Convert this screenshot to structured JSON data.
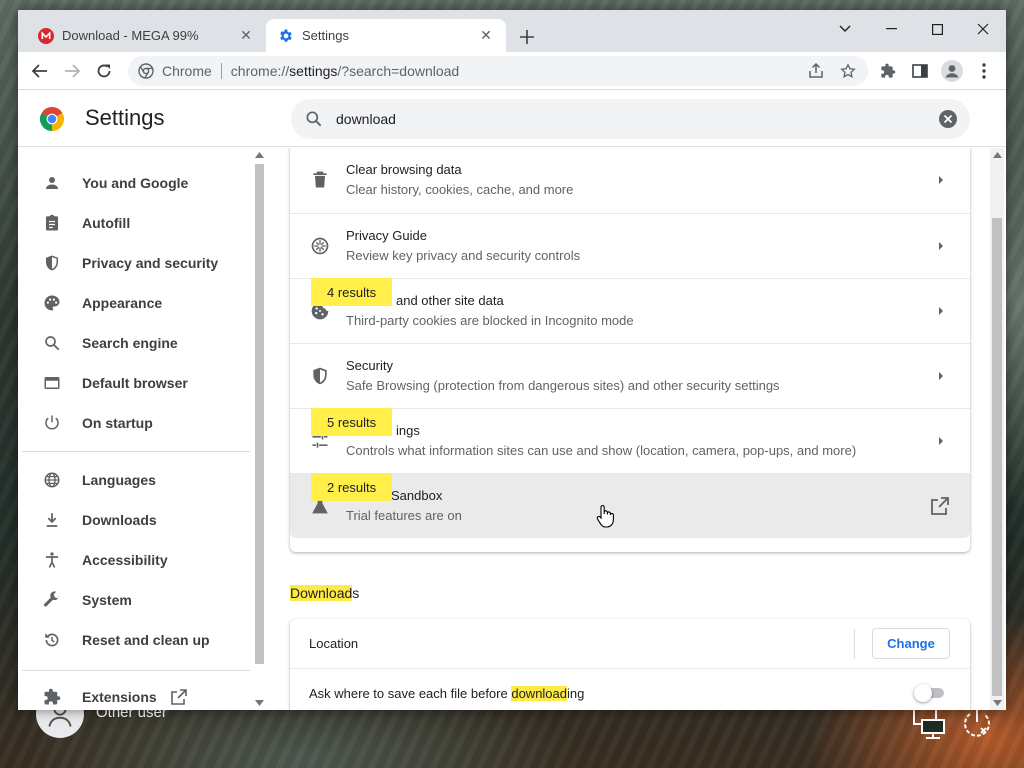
{
  "tabs": [
    {
      "title": "Download - MEGA 99%",
      "active": false
    },
    {
      "title": "Settings",
      "active": true
    }
  ],
  "omnibox": {
    "chip": "Chrome",
    "url_host": "chrome://",
    "url_path": "settings",
    "url_rest": "/?search=download"
  },
  "header": {
    "title": "Settings"
  },
  "search": {
    "query": "download"
  },
  "sidebar": {
    "items": [
      {
        "label": "You and Google",
        "icon": "person-icon"
      },
      {
        "label": "Autofill",
        "icon": "clipboard-icon"
      },
      {
        "label": "Privacy and security",
        "icon": "shield-icon"
      },
      {
        "label": "Appearance",
        "icon": "palette-icon"
      },
      {
        "label": "Search engine",
        "icon": "search-icon"
      },
      {
        "label": "Default browser",
        "icon": "browser-window-icon"
      },
      {
        "label": "On startup",
        "icon": "power-icon"
      },
      {
        "label": "Languages",
        "icon": "globe-icon"
      },
      {
        "label": "Downloads",
        "icon": "download-icon"
      },
      {
        "label": "Accessibility",
        "icon": "accessibility-icon"
      },
      {
        "label": "System",
        "icon": "wrench-icon"
      },
      {
        "label": "Reset and clean up",
        "icon": "reset-icon"
      },
      {
        "label": "Extensions",
        "icon": "puzzle-icon"
      }
    ]
  },
  "privacy_rows": [
    {
      "title": "Clear browsing data",
      "subtitle": "Clear history, cookies, cache, and more",
      "icon": "trash-icon"
    },
    {
      "title": "Privacy Guide",
      "subtitle": "Review key privacy and security controls",
      "icon": "compass-icon"
    },
    {
      "title": "Cookies and other site data",
      "title_visible": "and other site data",
      "subtitle": "Third-party cookies are blocked in Incognito mode",
      "icon": "cookie-icon",
      "bubble": "4 results"
    },
    {
      "title": "Security",
      "subtitle": "Safe Browsing (protection from dangerous sites) and other security settings",
      "icon": "shield-icon"
    },
    {
      "title": "Site Settings",
      "title_visible": "ings",
      "subtitle": "Controls what information sites can use and show (location, camera, pop-ups, and more)",
      "icon": "sliders-icon",
      "bubble": "5 results"
    },
    {
      "title": "Privacy Sandbox",
      "title_visible": "Sandbox",
      "subtitle": "Trial features are on",
      "icon": "flask-icon",
      "bubble": "2 results"
    }
  ],
  "downloads": {
    "title_highlight": "Download",
    "title_rest": "s",
    "location_label": "Location",
    "change_label": "Change",
    "ask_pre": "Ask where to save each file before ",
    "ask_highlight": "download",
    "ask_post": "ing",
    "ask_enabled": false
  },
  "desktop": {
    "user_name": "Other user"
  },
  "colors": {
    "highlight": "#fdea47",
    "accent": "#1a73e8",
    "bubble": "#ffef48"
  }
}
